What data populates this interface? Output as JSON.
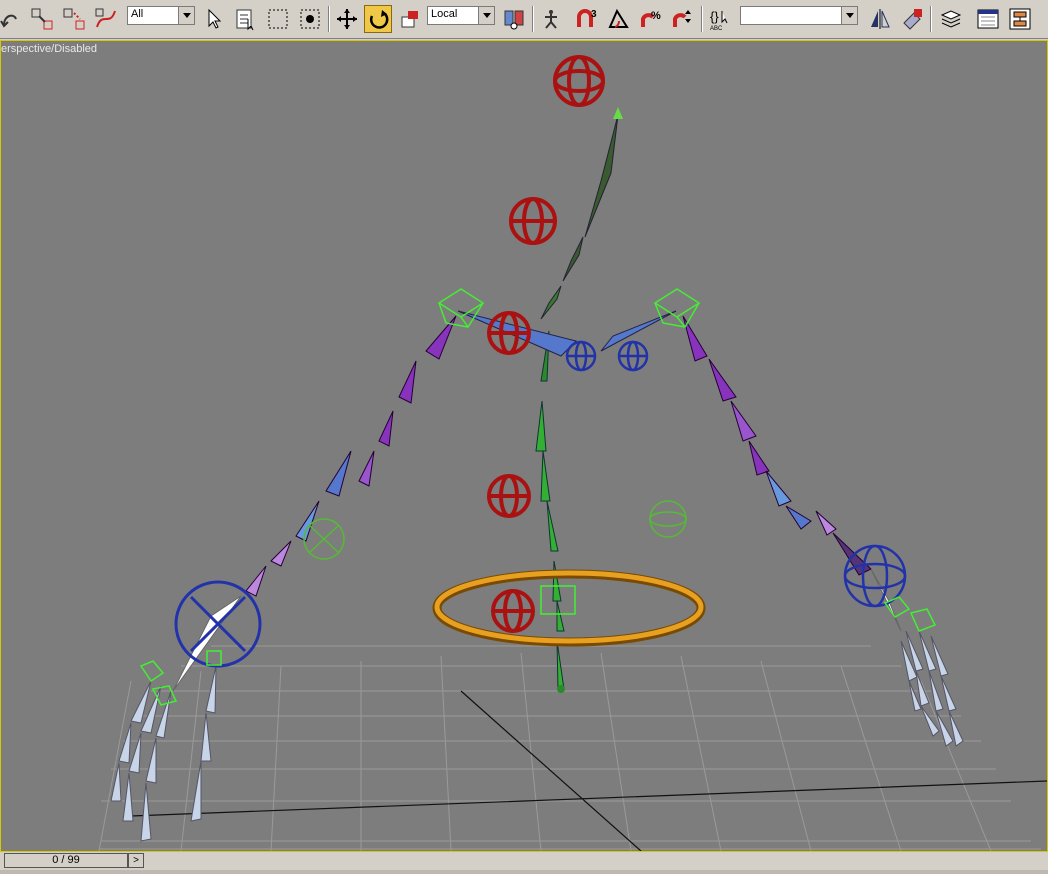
{
  "toolbar": {
    "selection_filter": "All",
    "coordinate_system": "Local",
    "named_selection": ""
  },
  "viewport": {
    "label": "erspective/Disabled"
  },
  "timeline": {
    "frame_readout": "0 / 99",
    "next_label": ">"
  }
}
